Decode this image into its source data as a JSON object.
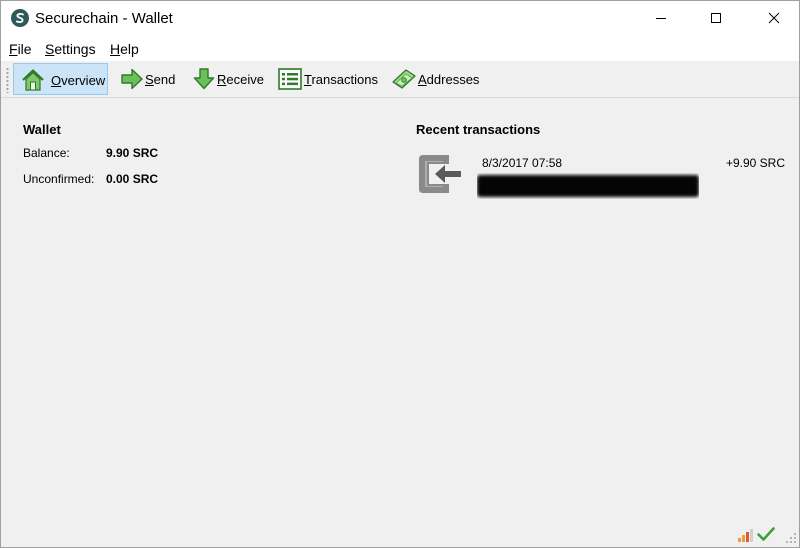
{
  "window": {
    "title": "Securechain - Wallet",
    "icons": {
      "app": "securechain-logo-icon",
      "minimize": "minimize-icon",
      "maximize": "maximize-icon",
      "close": "close-icon"
    }
  },
  "menu": {
    "file": {
      "mnemonic": "F",
      "rest": "ile"
    },
    "settings": {
      "mnemonic": "S",
      "rest": "ettings"
    },
    "help": {
      "mnemonic": "H",
      "rest": "elp"
    }
  },
  "toolbar": {
    "overview": {
      "mnemonic": "O",
      "rest": "verview",
      "icon": "home-icon",
      "active": true
    },
    "send": {
      "mnemonic": "S",
      "rest": "end",
      "icon": "send-arrow-icon"
    },
    "receive": {
      "mnemonic": "R",
      "rest": "eceive",
      "icon": "receive-arrow-icon"
    },
    "transactions": {
      "mnemonic": "T",
      "rest": "ransactions",
      "icon": "transactions-list-icon"
    },
    "addresses": {
      "mnemonic": "A",
      "rest": "ddresses",
      "icon": "address-book-icon"
    }
  },
  "wallet": {
    "title": "Wallet",
    "balance_label": "Balance:",
    "balance_value": "9.90 SRC",
    "unconfirmed_label": "Unconfirmed:",
    "unconfirmed_value": "0.00 SRC"
  },
  "recent": {
    "title": "Recent transactions",
    "transactions": [
      {
        "date": "8/3/2017 07:58",
        "amount": "+9.90 SRC",
        "icon": "incoming-transaction-icon",
        "address_redacted": true
      }
    ]
  },
  "status": {
    "icons": [
      "connections-signal-icon",
      "synced-check-icon",
      "resize-grip-icon"
    ]
  },
  "colors": {
    "active_tab_bg": "#cce4f7",
    "active_tab_border": "#99c9ef",
    "icon_green": "#4aa83c",
    "check_green": "#39a33a"
  }
}
